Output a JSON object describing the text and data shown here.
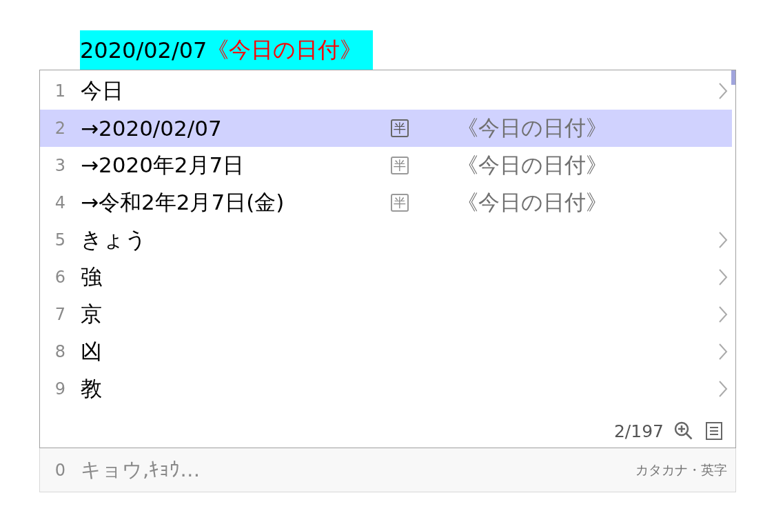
{
  "composition": {
    "text": "2020/02/07",
    "annotation": "《今日の日付》"
  },
  "candidates": [
    {
      "number": "1",
      "text": "今日",
      "has_submenu": true,
      "selected": false
    },
    {
      "number": "2",
      "text": "→2020/02/07",
      "badge": "半",
      "comment": "《今日の日付》",
      "has_submenu": false,
      "selected": true
    },
    {
      "number": "3",
      "text": "→2020年2月7日",
      "badge": "半",
      "comment": "《今日の日付》",
      "has_submenu": false,
      "selected": false
    },
    {
      "number": "4",
      "text": "→令和2年2月7日(金)",
      "badge": "半",
      "comment": "《今日の日付》",
      "has_submenu": false,
      "selected": false
    },
    {
      "number": "5",
      "text": "きょう",
      "has_submenu": true,
      "selected": false
    },
    {
      "number": "6",
      "text": "強",
      "has_submenu": true,
      "selected": false
    },
    {
      "number": "7",
      "text": "京",
      "has_submenu": true,
      "selected": false
    },
    {
      "number": "8",
      "text": "凶",
      "has_submenu": true,
      "selected": false
    },
    {
      "number": "9",
      "text": "教",
      "has_submenu": true,
      "selected": false
    }
  ],
  "footer": {
    "position": "2/197"
  },
  "bottom_bar": {
    "number": "0",
    "text": "キョウ,ｷｮｳ…",
    "mode": "カタカナ・英字"
  }
}
